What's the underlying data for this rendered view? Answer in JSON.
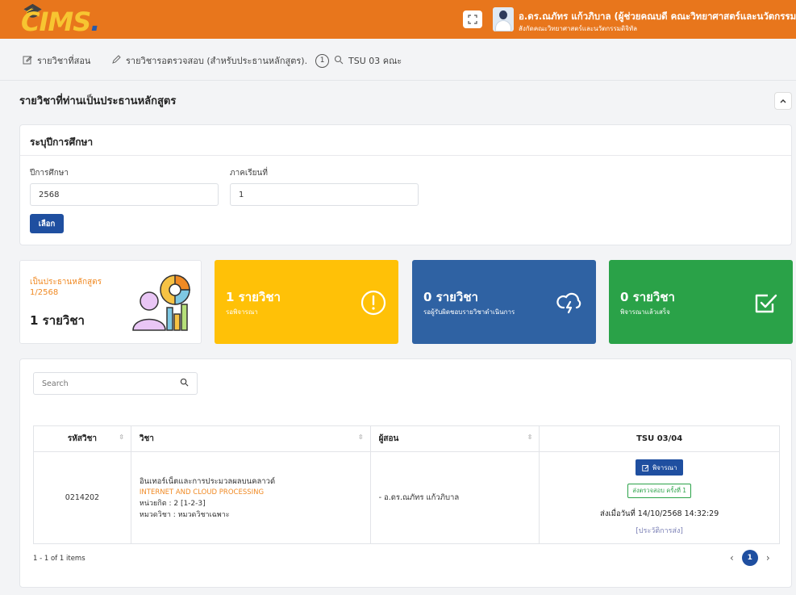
{
  "header": {
    "logo_text": "CIMS",
    "logo_sub": "COURSE INFORMATION MANAGEMENT SYSTEM",
    "user_name": "อ.ดร.ณภัทร แก้วภิบาล (ผู้ช่วยคณบดี คณะวิทยาศาสตร์และนวัตกรรมดิจิทัล)",
    "user_dept": "สังกัดคณะวิทยาศาสตร์และนวัตกรรมดิจิทัล",
    "brand_color": "#e8761c"
  },
  "nav": {
    "items": [
      {
        "label": "รายวิชาที่สอน",
        "icon": "edit-icon"
      },
      {
        "label": "รายวิชารอตรวจสอบ (สำหรับประธานหลักสูตร).",
        "icon": "pen-icon",
        "count": "1"
      },
      {
        "label": "TSU 03 คณะ",
        "icon": "search-icon"
      }
    ]
  },
  "page_title": "รายวิชาที่ท่านเป็นประธานหลักสูตร",
  "semester_form": {
    "title": "ระบุปีการศึกษา",
    "year_label": "ปีการศึกษา",
    "year_value": "2568",
    "term_label": "ภาคเรียนที่",
    "term_value": "1",
    "submit_label": "เลือก"
  },
  "stats": [
    {
      "label": "เป็นประธานหลักสูตร 1/2568",
      "count": "1 รายวิชา",
      "color": "#ffffff"
    },
    {
      "count": "1 รายวิชา",
      "sub": "รอพิจารณา",
      "icon": "exclamation-circle-icon",
      "color": "#ffc107"
    },
    {
      "count": "0 รายวิชา",
      "sub": "รอผู้รับผิดชอบรายวิชาดำเนินการ",
      "icon": "cloud-lightning-icon",
      "color": "#2f62a3"
    },
    {
      "count": "0 รายวิชา",
      "sub": "พิจารณาแล้วเสร็จ",
      "icon": "check-square-icon",
      "color": "#2aa248"
    }
  ],
  "table": {
    "search_placeholder": "Search",
    "columns": [
      "รหัสวิชา",
      "วิชา",
      "ผู้สอน",
      "TSU 03/04"
    ],
    "rows": [
      {
        "code": "0214202",
        "subject_th": "อินเทอร์เน็ตและการประมวลผลบนคลาวด์",
        "subject_en": "INTERNET AND CLOUD PROCESSING",
        "credits": "หน่วยกิต : 2 [1-2-3]",
        "category": "หมวดวิชา : หมวดวิชาเฉพาะ",
        "teacher": "- อ.ดร.ณภัทร แก้วภิบาล",
        "action_label": "พิจารณา",
        "status": "ส่งตรวจสอบ ครั้งที่ 1",
        "sent_date": "ส่งเมื่อวันที่ 14/10/2568 14:32:29",
        "history_label": "[ประวัติการส่ง]"
      }
    ],
    "page_info": "1 - 1 of 1 items",
    "current_page": "1"
  }
}
